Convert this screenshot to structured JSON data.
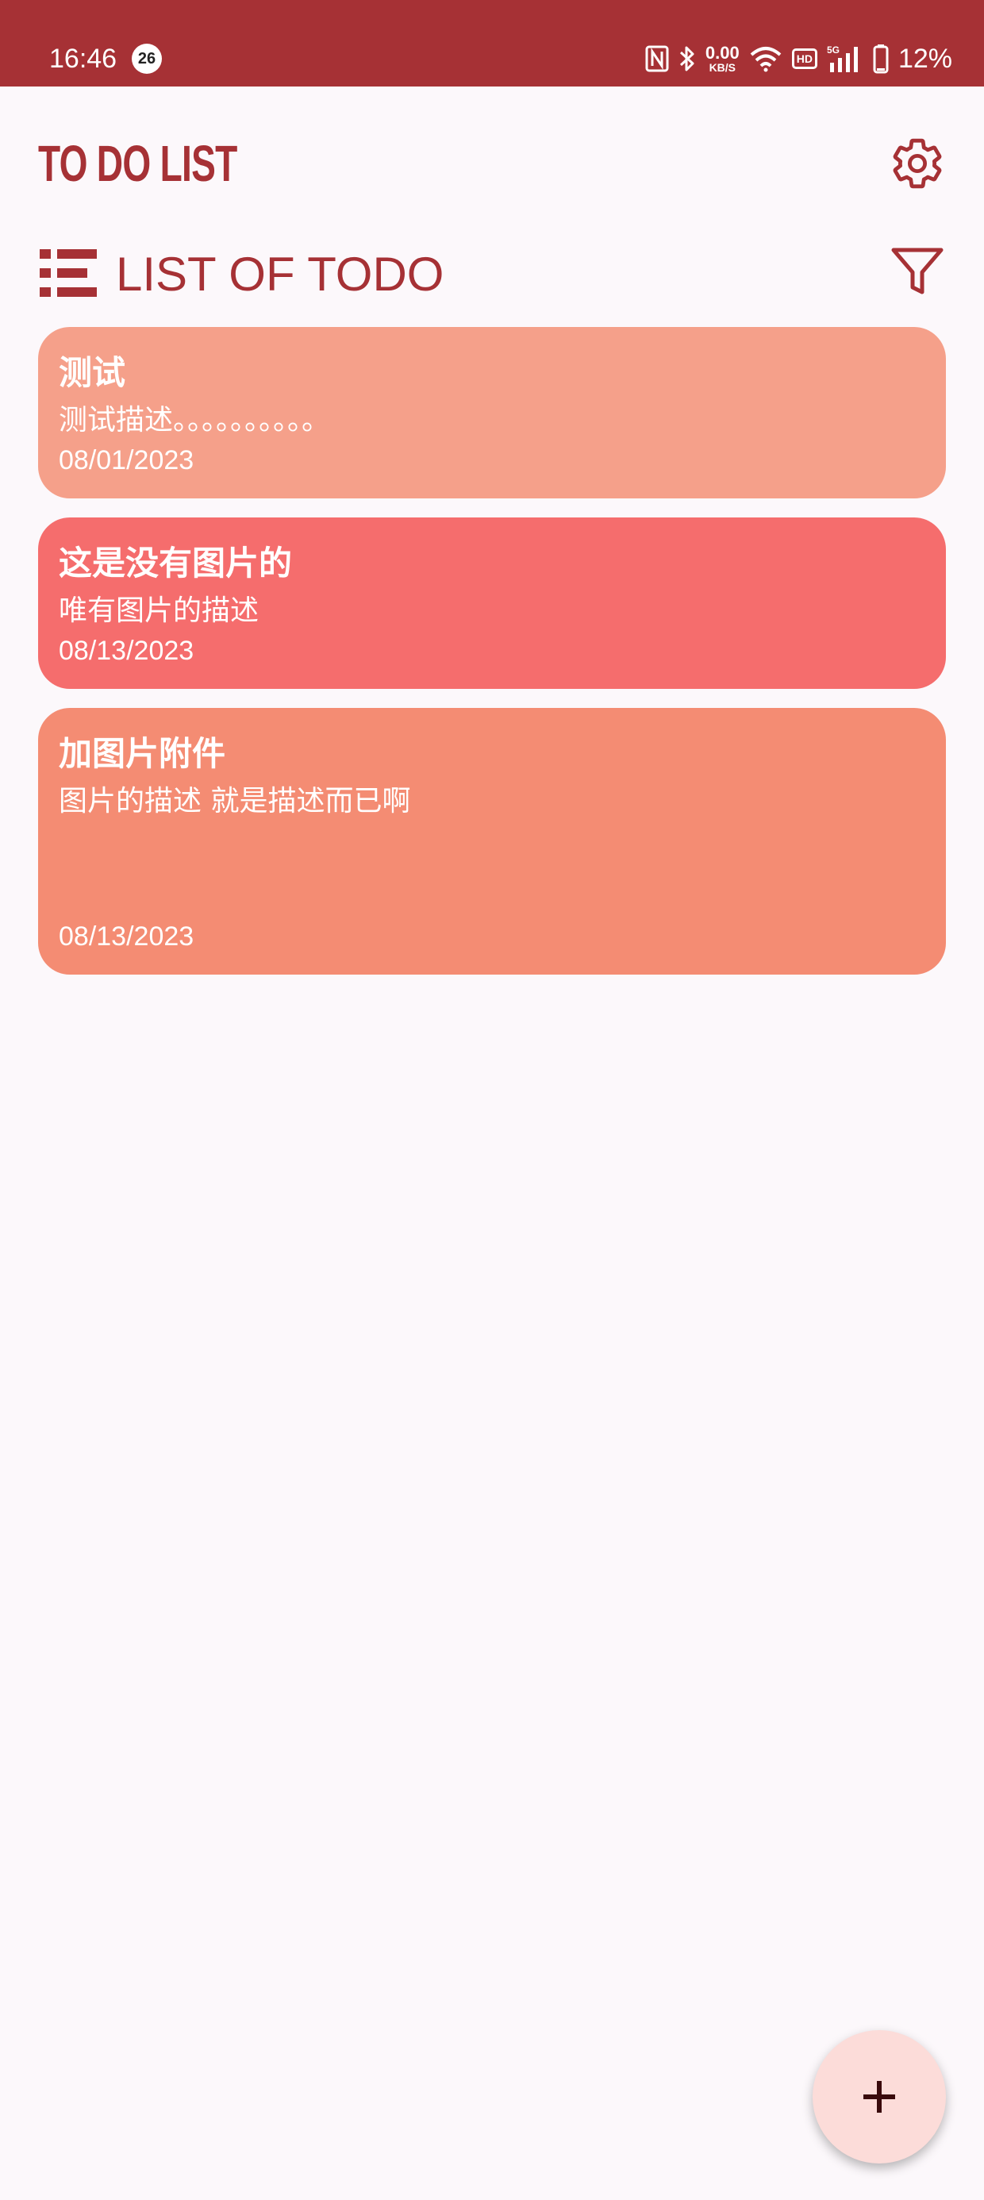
{
  "status_bar": {
    "time": "16:46",
    "notification_count": "26",
    "net_speed_value": "0.00",
    "net_speed_unit": "KB/S",
    "hd_label": "HD",
    "signal_label": "5G",
    "battery_percent": "12%"
  },
  "header": {
    "app_title": "TO DO LIST",
    "settings_icon": "gear-icon"
  },
  "section": {
    "title": "LIST OF TODO",
    "list_icon": "list-icon",
    "filter_icon": "filter-icon"
  },
  "todos": [
    {
      "title": "测试",
      "description": "测试描述。。。。。。。。。。",
      "date": "08/01/2023",
      "color": "#f5a08a"
    },
    {
      "title": "这是没有图片的",
      "description": "唯有图片的描述",
      "date": "08/13/2023",
      "color": "#f56d6d"
    },
    {
      "title": "加图片附件",
      "description": "图片的描述 就是描述而已啊",
      "date": "08/13/2023",
      "color": "#f48c73"
    }
  ],
  "fab": {
    "icon": "plus-icon"
  },
  "colors": {
    "accent": "#a63135",
    "background": "#fcf8fb",
    "fab_background": "#fcdcd9"
  }
}
